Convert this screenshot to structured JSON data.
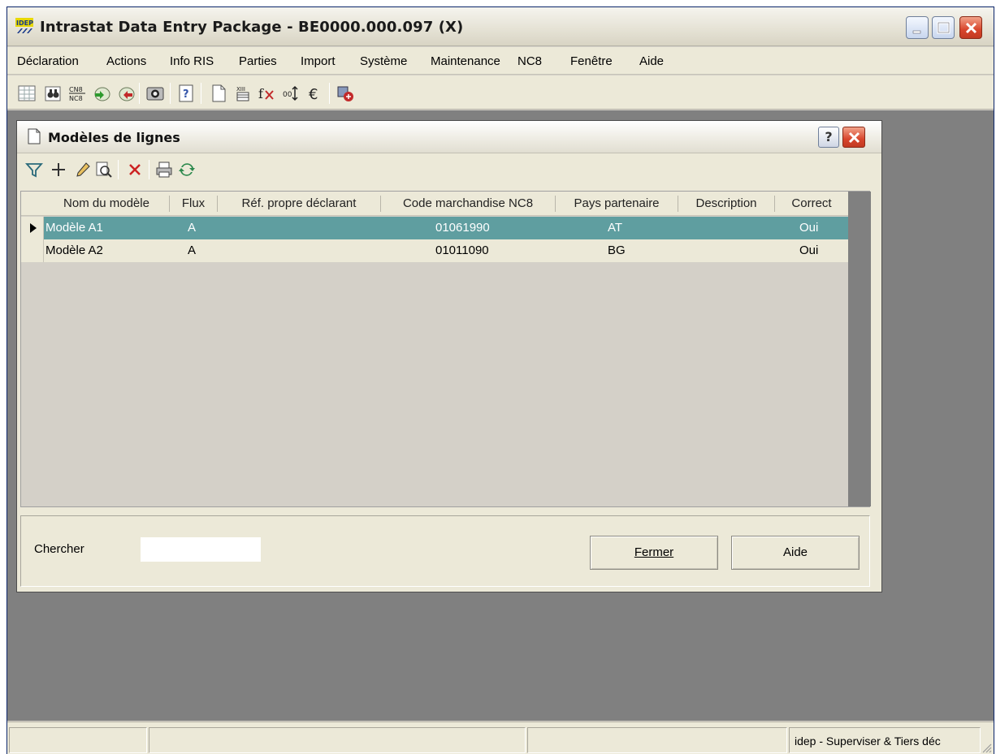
{
  "window": {
    "title": "Intrastat Data Entry Package - BE0000.000.097 (X)",
    "logo_text": "IDEP"
  },
  "menu": [
    "Déclaration",
    "Actions",
    "Info RIS",
    "Parties",
    "Import",
    "Système",
    "Maintenance",
    "NC8",
    "Fenêtre",
    "Aide"
  ],
  "toolbar": {
    "cn8_label_top": "CN8",
    "cn8_label_bottom": "NC8"
  },
  "dialog": {
    "title": "Modèles de lignes",
    "help_glyph": "?",
    "columns": [
      "Nom du modèle",
      "Flux",
      "Réf. propre déclarant",
      "Code marchandise NC8",
      "Pays partenaire",
      "Description",
      "Correct"
    ],
    "rows": [
      {
        "name": "Modèle A1",
        "flux": "A",
        "ref": "",
        "code": "01061990",
        "country": "AT",
        "description": "",
        "correct": "Oui",
        "selected": true
      },
      {
        "name": "Modèle A2",
        "flux": "A",
        "ref": "",
        "code": "01011090",
        "country": "BG",
        "description": "",
        "correct": "Oui",
        "selected": false
      }
    ],
    "search_label": "Chercher",
    "search_value": "",
    "close_button_label": "Fermer",
    "help_button_label": "Aide"
  },
  "status": {
    "pane3": "idep - Superviser & Tiers déc"
  }
}
